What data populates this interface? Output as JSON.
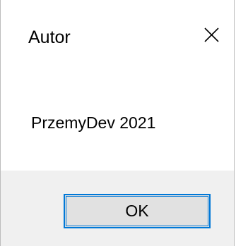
{
  "window": {
    "title": "Autor"
  },
  "message": {
    "text": "PrzemyDev 2021"
  },
  "buttons": {
    "ok_label": "OK"
  },
  "icons": {
    "close": "close-icon"
  },
  "colors": {
    "accent": "#0078d7",
    "footer_bg": "#f0f0f0",
    "button_bg": "#e1e1e1"
  }
}
